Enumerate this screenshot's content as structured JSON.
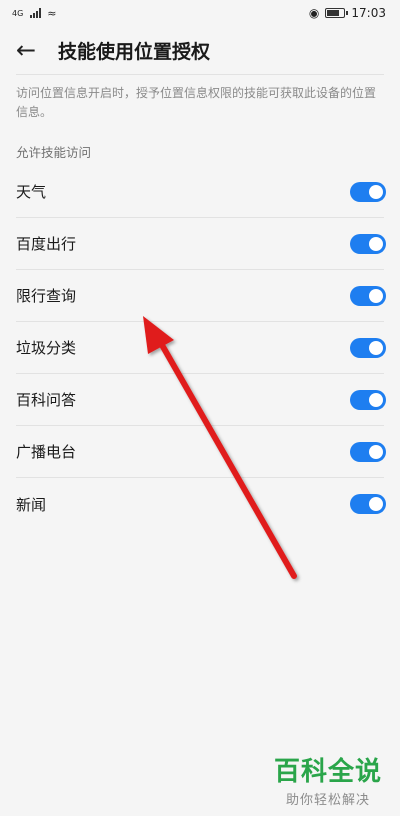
{
  "status_bar": {
    "signal_tag": "4G",
    "time": "17:03",
    "icons": [
      "signal-icon",
      "wifi-icon",
      "eye-icon",
      "battery-icon"
    ]
  },
  "header": {
    "title": "技能使用位置授权"
  },
  "description": "访问位置信息开启时，授予位置信息权限的技能可获取此设备的位置信息。",
  "section_label": "允许技能访问",
  "skills": [
    {
      "label": "天气",
      "enabled": true
    },
    {
      "label": "百度出行",
      "enabled": true
    },
    {
      "label": "限行查询",
      "enabled": true
    },
    {
      "label": "垃圾分类",
      "enabled": true
    },
    {
      "label": "百科问答",
      "enabled": true
    },
    {
      "label": "广播电台",
      "enabled": true
    },
    {
      "label": "新闻",
      "enabled": true
    }
  ],
  "watermark": {
    "title": "百科全说",
    "subtitle": "助你轻松解决"
  },
  "colors": {
    "toggle_on": "#1e7ef0",
    "annotation_arrow": "#e01e1e",
    "watermark": "#2aa54a"
  }
}
